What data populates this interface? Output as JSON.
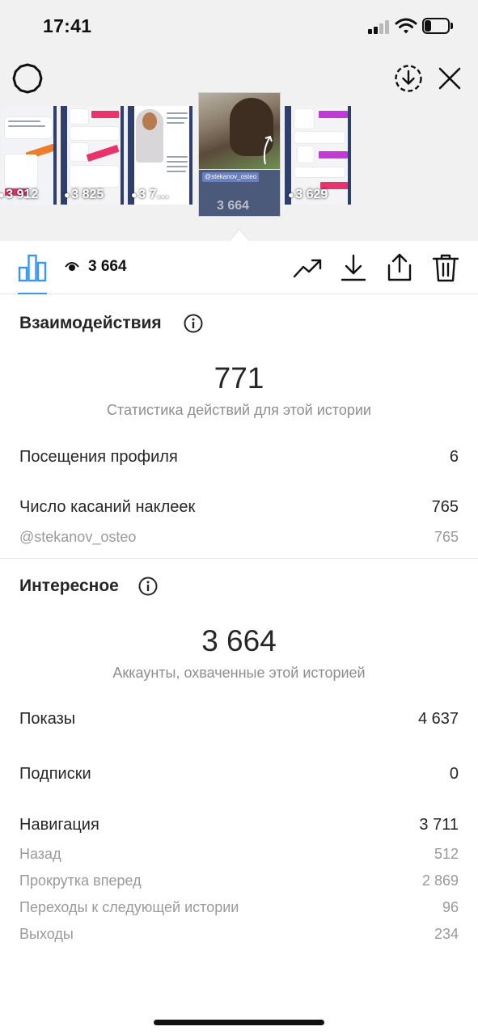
{
  "status_bar": {
    "time": "17:41",
    "battery_level": 0.3
  },
  "header": {
    "settings_icon": "gear-icon",
    "download_all_icon": "circle-download-icon",
    "close_icon": "close-icon"
  },
  "thumbnails": [
    {
      "views": "3 912"
    },
    {
      "views": "3 825"
    },
    {
      "views": "3 7…"
    },
    {
      "views": "3 664",
      "sticker": "@stekanov_osteo",
      "current": true
    },
    {
      "views": "3 629"
    }
  ],
  "toolbar": {
    "reach": "3 664",
    "icons": [
      "bar-chart-icon",
      "eye-icon",
      "trending-icon",
      "download-icon",
      "share-icon",
      "trash-icon"
    ],
    "accent": "#3897f0"
  },
  "interactions": {
    "title": "Взаимодействия",
    "total": "771",
    "caption": "Статистика действий для этой истории",
    "rows": [
      {
        "label": "Посещения профиля",
        "value": "6"
      },
      {
        "label": "Число касаний наклеек",
        "value": "765"
      }
    ],
    "sub_rows": [
      {
        "label": "@stekanov_osteo",
        "value": "765"
      }
    ]
  },
  "discovery": {
    "title": "Интересное",
    "total": "3 664",
    "caption": "Аккаунты, охваченные этой историей",
    "rows": [
      {
        "label": "Показы",
        "value": "4 637"
      },
      {
        "label": "Подписки",
        "value": "0"
      },
      {
        "label": "Навигация",
        "value": "3 711"
      }
    ],
    "sub_rows": [
      {
        "label": "Назад",
        "value": "512"
      },
      {
        "label": "Прокрутка вперед",
        "value": "2 869"
      },
      {
        "label": "Переходы к следующей истории",
        "value": "96"
      },
      {
        "label": "Выходы",
        "value": "234"
      }
    ]
  }
}
